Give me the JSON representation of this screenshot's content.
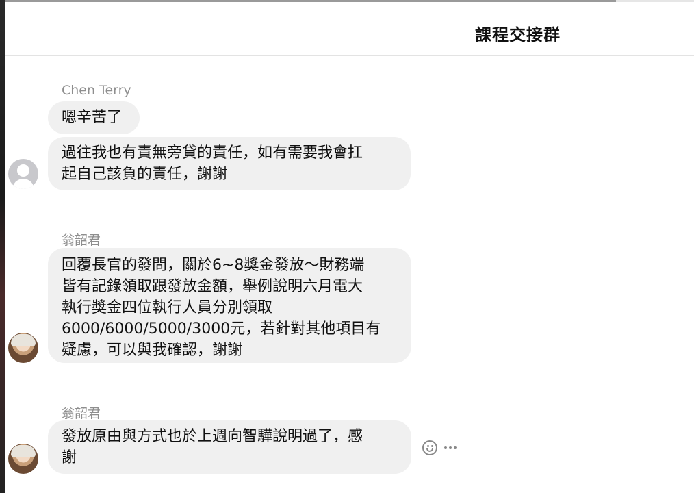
{
  "header": {
    "title": "課程交接群"
  },
  "messages": [
    {
      "sender": "Chen Terry",
      "bubbles": [
        "嗯辛苦了",
        "過往我也有責無旁貸的責任，如有需要我會扛\n起自己該負的責任，謝謝"
      ],
      "avatar": "placeholder-avatar"
    },
    {
      "sender": "翁韶君",
      "bubbles": [
        "回覆長官的發問，關於6~8獎金發放～財務端\n皆有記錄領取跟發放金額，舉例說明六月電大\n執行獎金四位執行人員分別領取\n6000/6000/5000/3000元，若針對其他項目有\n疑慮，可以與我確認，謝謝"
      ],
      "avatar": "photo-avatar"
    },
    {
      "sender": "翁韶君",
      "bubbles": [
        "發放原由與方式也於上週向智驊說明過了，感\n謝"
      ],
      "avatar": "photo-avatar"
    }
  ],
  "message_actions": {
    "react_icon": "emoji-icon",
    "more_icon": "more-icon"
  }
}
